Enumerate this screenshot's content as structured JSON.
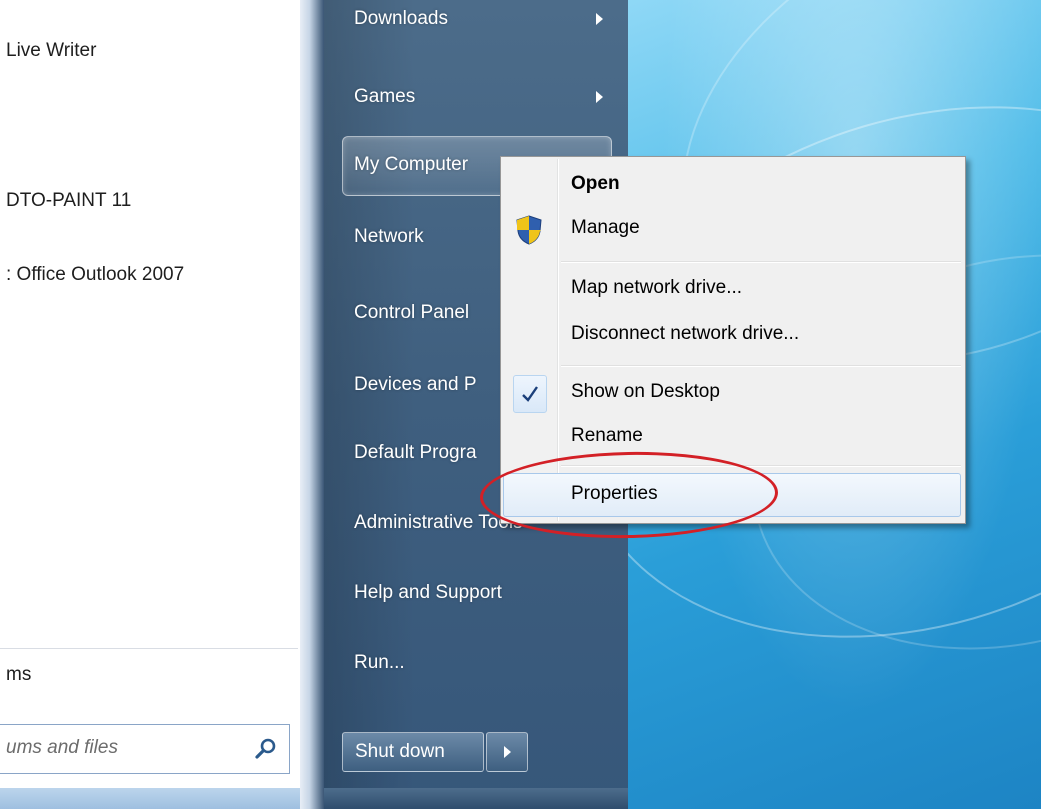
{
  "left_pane": {
    "programs": [
      "Live Writer",
      "DTO-PAINT 11",
      ": Office Outlook 2007"
    ],
    "all_programs_label": "ms",
    "search_placeholder": "ums and files"
  },
  "right_pane": {
    "items": [
      "Downloads",
      "Games",
      "My Computer",
      "Network",
      "Control Panel",
      "Devices and P",
      "Default Progra",
      "Administrative Tools",
      "Help and Support",
      "Run..."
    ],
    "shutdown_label": "Shut down"
  },
  "context_menu": {
    "open": "Open",
    "manage": "Manage",
    "map_drive": "Map network drive...",
    "disconnect_drive": "Disconnect network drive...",
    "show_desktop": "Show on Desktop",
    "show_desktop_checked": true,
    "rename": "Rename",
    "properties": "Properties"
  },
  "colors": {
    "annotation_circle": "#d32026",
    "start_right_pane": "#3f5f7f",
    "desktop": "#3aaee2"
  },
  "icons": {
    "search": "magnifier-icon",
    "uac_shield": "shield-icon",
    "check": "checkmark-icon",
    "submenu_arrow": "arrow-right-icon"
  }
}
